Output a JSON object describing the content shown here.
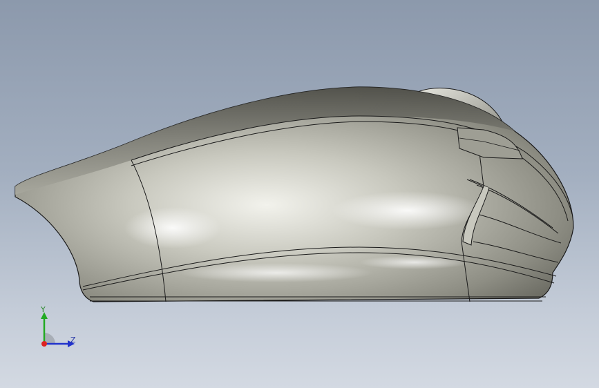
{
  "viewport": {
    "background_top": "#8c99ac",
    "background_bottom": "#d3d9e2",
    "model_name": "mouse-side-view",
    "model_color": "#b8b8ae",
    "edge_color": "#1a1a1a"
  },
  "triad": {
    "y_label": "Y",
    "z_label": "Z",
    "y_color": "#22aa22",
    "z_color": "#2233cc",
    "x_color": "#dd2222"
  }
}
